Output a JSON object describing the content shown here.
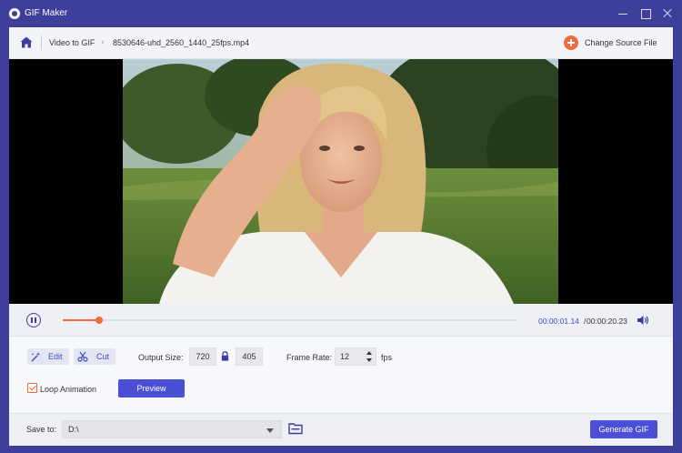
{
  "window": {
    "title": "GIF Maker",
    "accent_color": "#3d3f9b",
    "highlight_color": "#f26a3c",
    "button_color": "#4a4fd6"
  },
  "breadcrumb": {
    "home_icon": "home-icon",
    "section": "Video to GIF",
    "file_name": "8530646-uhd_2560_1440_25fps.mp4",
    "change_source_label": "Change Source File"
  },
  "playback": {
    "current_time": "00:00:01.14",
    "separator": "/",
    "total_time": "00:00:20.23",
    "progress": 0.08
  },
  "settings": {
    "edit_label": "Edit",
    "cut_label": "Cut",
    "output_size_label": "Output Size:",
    "width": "720",
    "height": "405",
    "frame_rate_label": "Frame Rate:",
    "frame_rate": "12",
    "fps_label": "fps",
    "loop_label": "Loop Animation",
    "loop_checked": true,
    "preview_label": "Preview"
  },
  "footer": {
    "save_to_label": "Save to:",
    "save_path": "D:\\",
    "generate_label": "Generate GIF"
  }
}
